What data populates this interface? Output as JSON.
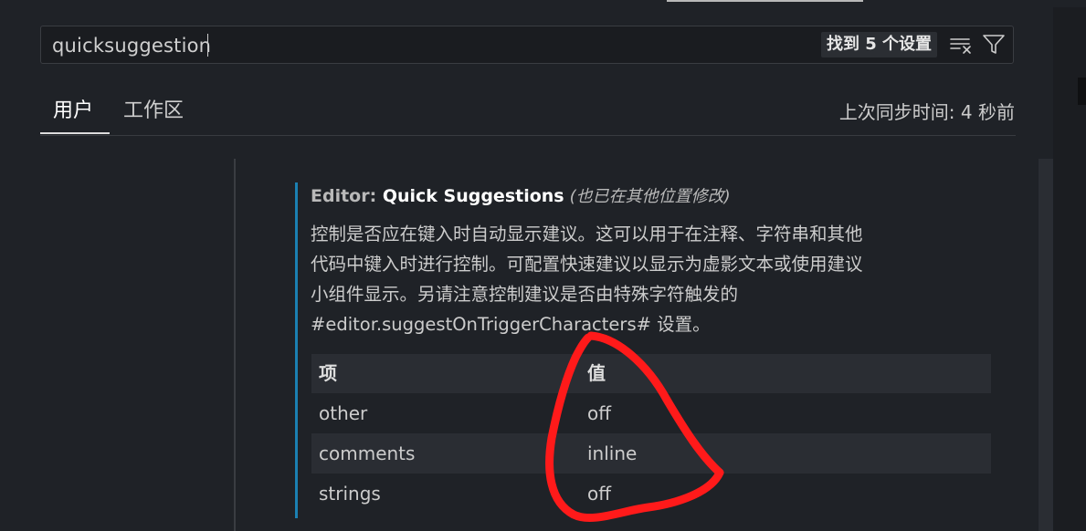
{
  "search": {
    "value": "quicksuggestion",
    "result_count_label": "找到 5 个设置",
    "clear_icon": "clear-filter-icon",
    "filter_icon": "filter-icon"
  },
  "tabs": [
    {
      "label": "用户",
      "active": true
    },
    {
      "label": "工作区",
      "active": false
    }
  ],
  "sync_status": "上次同步时间: 4 秒前",
  "setting": {
    "category": "Editor: ",
    "name": "Quick Suggestions",
    "modified_note": "(也已在其他位置修改)",
    "description_lines": [
      "控制是否应在键入时自动显示建议。这可以用于在注释、字符串和其他",
      "代码中键入时进行控制。可配置快速建议以显示为虚影文本或使用建议",
      "小组件显示。另请注意控制建议是否由特殊字符触发的",
      "#editor.suggestOnTriggerCharacters# 设置。"
    ],
    "table": {
      "headers": [
        "项",
        "值"
      ],
      "rows": [
        [
          "other",
          "off"
        ],
        [
          "comments",
          "inline"
        ],
        [
          "strings",
          "off"
        ]
      ]
    }
  },
  "colors": {
    "background": "#1f2227",
    "modified_indicator": "#1b80b2",
    "annotation": "#ff1a1a"
  }
}
